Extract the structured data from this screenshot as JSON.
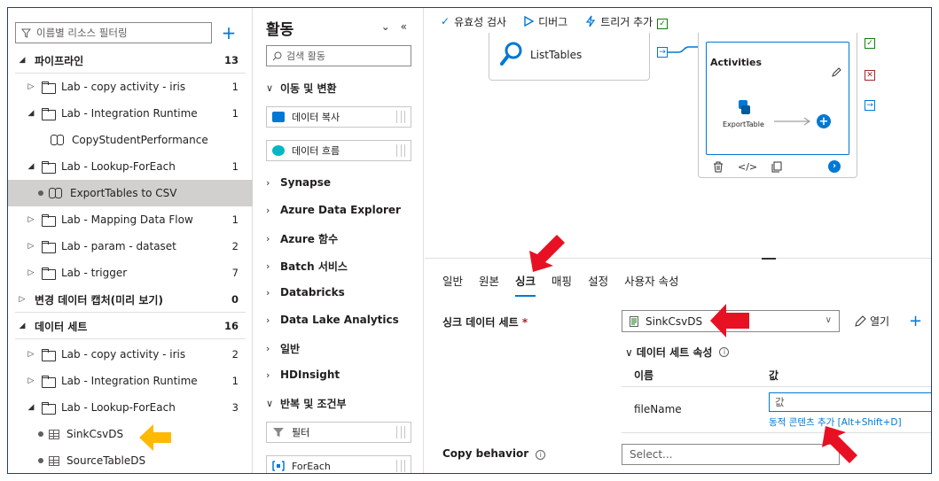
{
  "left_pane": {
    "filter_placeholder": "이름별 리소스 필터링",
    "rows": [
      {
        "label": "파이프라인",
        "count": "13"
      },
      {
        "label": "Lab - copy activity - iris",
        "count": "1"
      },
      {
        "label": "Lab - Integration Runtime",
        "count": "1"
      },
      {
        "label": "CopyStudentPerformance",
        "count": ""
      },
      {
        "label": "Lab - Lookup-ForEach",
        "count": "1"
      },
      {
        "label": "ExportTables to CSV",
        "count": ""
      },
      {
        "label": "Lab - Mapping Data Flow",
        "count": "1"
      },
      {
        "label": "Lab - param - dataset",
        "count": "2"
      },
      {
        "label": "Lab - trigger",
        "count": "7"
      },
      {
        "label": "변경 데이터 캡처(미리 보기)",
        "count": "0"
      },
      {
        "label": "데이터 세트",
        "count": "16"
      },
      {
        "label": "Lab - copy activity - iris",
        "count": "2"
      },
      {
        "label": "Lab - Integration Runtime",
        "count": "1"
      },
      {
        "label": "Lab - Lookup-ForEach",
        "count": "3"
      },
      {
        "label": "SinkCsvDS",
        "count": ""
      },
      {
        "label": "SourceTableDS",
        "count": ""
      }
    ]
  },
  "activities_pane": {
    "title": "활동",
    "search_placeholder": "검색 활동",
    "categories": {
      "move": "이동 및 변환",
      "synapse": "Synapse",
      "ade": "Azure Data Explorer",
      "func": "Azure 함수",
      "batch": "Batch 서비스",
      "databricks": "Databricks",
      "dla": "Data Lake Analytics",
      "general": "일반",
      "hdinsight": "HDInsight",
      "iteration": "반복 및 조건부"
    },
    "items": {
      "copy": "데이터 복사",
      "dataflow": "데이터 흐름",
      "filter": "필터",
      "foreach": "ForEach"
    }
  },
  "toolbar": {
    "validate": "유효성 검사",
    "debug": "디버그",
    "trigger": "트리거 추가"
  },
  "canvas": {
    "list_tables": "ListTables",
    "activities_title": "Activities",
    "export_table": "ExportTable"
  },
  "tabs": [
    "일반",
    "원본",
    "싱크",
    "매핑",
    "설정",
    "사용자 속성"
  ],
  "sink": {
    "dataset_label": "싱크 데이터 세트",
    "required_mark": "*",
    "dataset_value": "SinkCsvDS",
    "open_label": "열기",
    "props_header": "데이터 세트 속성",
    "col_name": "이름",
    "col_value": "값",
    "param_name": "fileName",
    "param_value": "값",
    "dynamic_link": "동적 콘텐츠 추가 [Alt+Shift+D]",
    "copy_behavior_label": "Copy behavior",
    "copy_behavior_placeholder": "Select..."
  },
  "colors": {
    "accent": "#0078d4",
    "success": "#107c10",
    "error": "#a4262c",
    "annotation_red": "#e81123",
    "annotation_yellow": "#ffb900"
  }
}
